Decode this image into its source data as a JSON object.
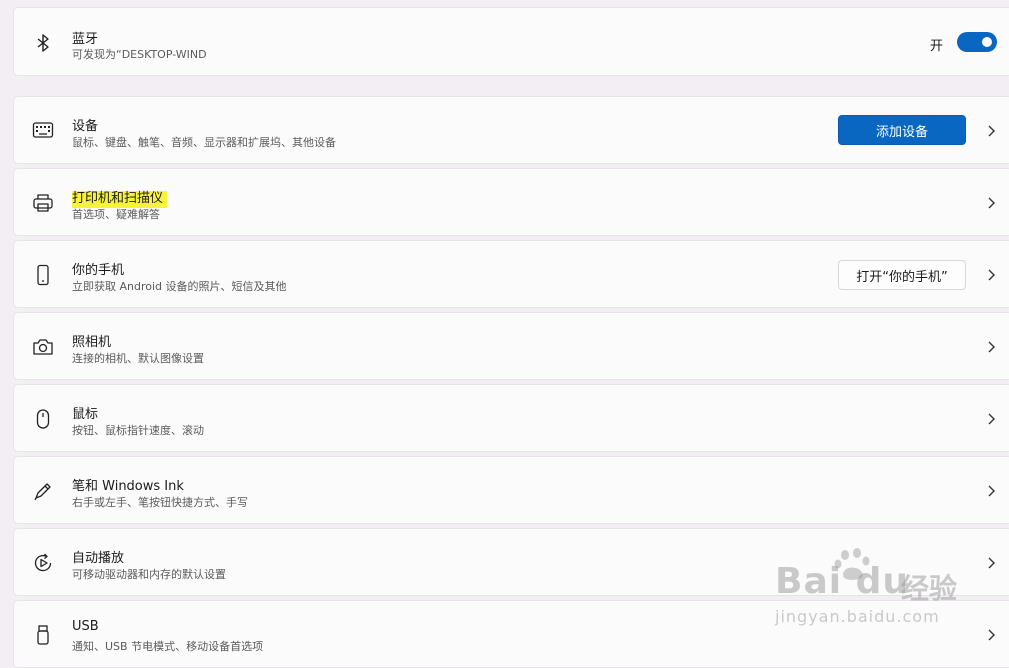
{
  "bluetooth": {
    "title": "蓝牙",
    "subtitle": "可发现为“DESKTOP-WIND",
    "toggle_label": "开",
    "toggle_on": true
  },
  "items": [
    {
      "title": "设备",
      "subtitle": "鼠标、键盘、触笔、音频、显示器和扩展坞、其他设备",
      "button": "添加设备",
      "icon": "keyboard-icon"
    },
    {
      "title": "打印机和扫描仪",
      "subtitle": "首选项、疑难解答",
      "icon": "printer-icon",
      "highlighted": true
    },
    {
      "title": "你的手机",
      "subtitle": "立即获取 Android 设备的照片、短信及其他",
      "button": "打开“你的手机”",
      "icon": "phone-icon"
    },
    {
      "title": "照相机",
      "subtitle": "连接的相机、默认图像设置",
      "icon": "camera-icon"
    },
    {
      "title": "鼠标",
      "subtitle": "按钮、鼠标指针速度、滚动",
      "icon": "mouse-icon"
    },
    {
      "title": "笔和 Windows Ink",
      "subtitle": "右手或左手、笔按钮快捷方式、手写",
      "icon": "pen-icon"
    },
    {
      "title": "自动播放",
      "subtitle": "可移动驱动器和内存的默认设置",
      "icon": "autoplay-icon"
    },
    {
      "title": "USB",
      "subtitle": "通知、USB 节电模式、移动设备首选项",
      "icon": "usb-icon"
    }
  ],
  "watermark": {
    "brand": "Bai du",
    "text": "经验",
    "url": "jingyan.baidu.com"
  },
  "colors": {
    "accent": "#0a67c1",
    "highlight": "#f7f339",
    "background": "#f3eef3"
  }
}
